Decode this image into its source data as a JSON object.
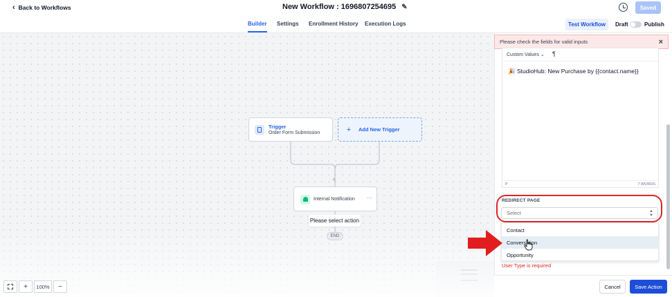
{
  "header": {
    "back_label": "Back to Workflows",
    "workflow_title": "New Workflow : 1696807254695",
    "saved_label": "Saved"
  },
  "tabs": [
    {
      "label": "Builder",
      "active": true
    },
    {
      "label": "Settings",
      "active": false
    },
    {
      "label": "Enrollment History",
      "active": false
    },
    {
      "label": "Execution Logs",
      "active": false
    }
  ],
  "toolbar": {
    "test_workflow_label": "Test Workflow",
    "draft_label": "Draft",
    "publish_label": "Publish"
  },
  "canvas": {
    "trigger": {
      "title": "Trigger",
      "subtitle": "Order Form Submission"
    },
    "add_trigger_label": "Add New Trigger",
    "action_node_label": "Internal Notification",
    "action_node_menu": "···",
    "select_action_label": "Please select action",
    "end_label": "END",
    "zoom_level": "100%"
  },
  "panel": {
    "alert_text": "Please check the fields for valid inputs",
    "editor": {
      "custom_values_label": "Custom Values",
      "paragraph_symbol": "¶",
      "content": "🎉 StudioHub: New Purchase by {{contact.name}}",
      "footer_tag": "P",
      "word_count": "7 WORDS"
    },
    "redirect_label": "REDIRECT PAGE",
    "redirect_placeholder": "Select",
    "redirect_options": [
      "Contact",
      "Conversation",
      "Opportunity"
    ],
    "error_text": "User Type is required",
    "cancel_label": "Cancel",
    "save_label": "Save Action"
  },
  "colors": {
    "accent": "#2563eb",
    "save_button": "#1d4ed8",
    "error": "#dc2626",
    "annotation": "#e11d1d"
  }
}
